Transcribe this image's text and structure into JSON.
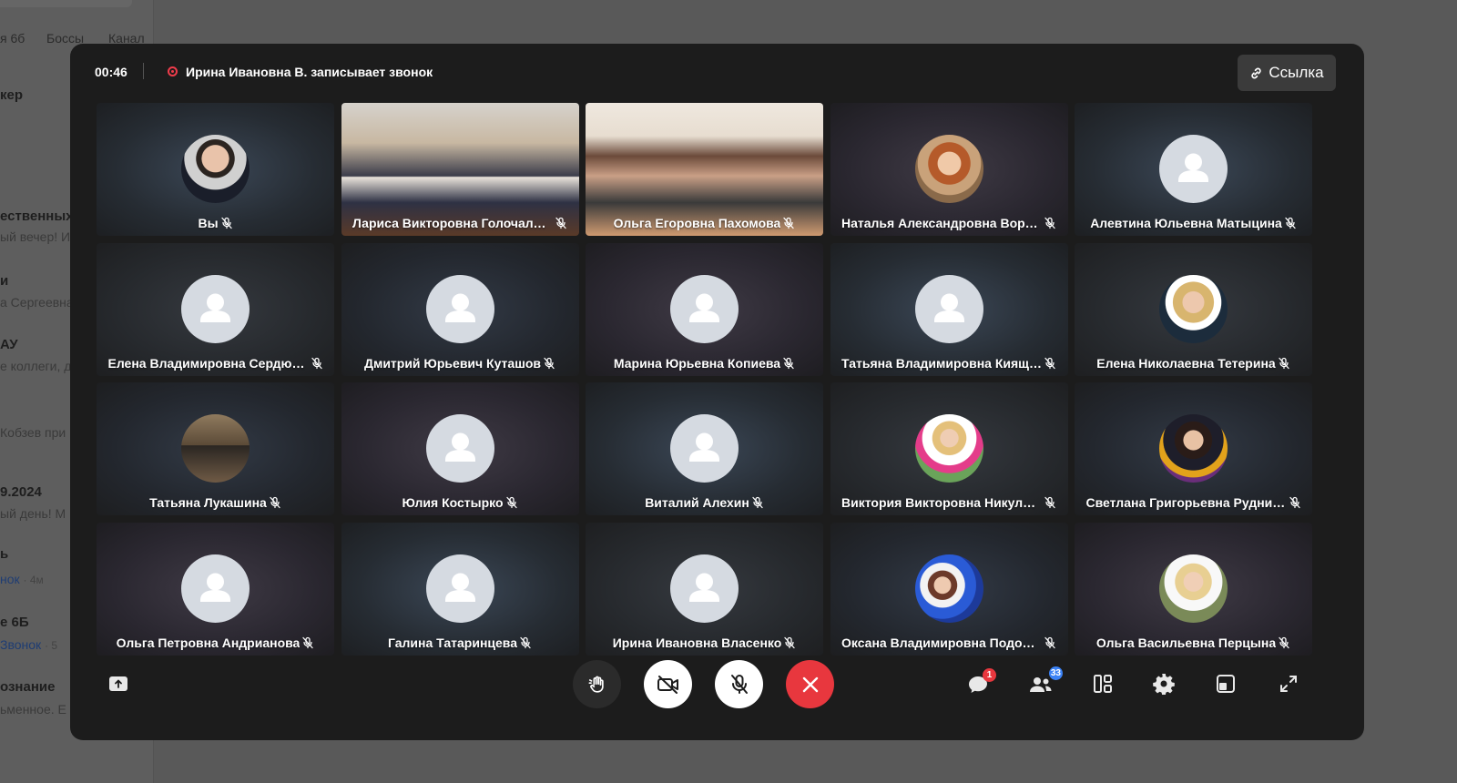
{
  "background": {
    "tabs": [
      "я 6б",
      "Боссы",
      "Канал"
    ],
    "items": [
      {
        "text": "кер",
        "style": "bold"
      },
      {
        "text": "ественных",
        "style": "bold"
      },
      {
        "text": "ый вечер! И",
        "style": "dim"
      },
      {
        "text": "и",
        "style": "bold"
      },
      {
        "text": "а Сергеевна",
        "style": "dim"
      },
      {
        "text": "АУ",
        "style": "bold"
      },
      {
        "text": "е коллеги, д",
        "style": "dim"
      },
      {
        "text": "Кобзев при",
        "style": "dim"
      },
      {
        "text": "9.2024",
        "style": "bold"
      },
      {
        "text": "ый день! М",
        "style": "dim"
      },
      {
        "text": "ь",
        "style": "bold"
      },
      {
        "text": "нок",
        "style": "link",
        "meta": "· 4м"
      },
      {
        "text": "е 6Б",
        "style": "bold"
      },
      {
        "text": "Звонок",
        "style": "link",
        "meta": "· 5"
      },
      {
        "text": "ознание",
        "style": "bold"
      },
      {
        "text": "ьменное. Е",
        "style": "dim"
      }
    ]
  },
  "call": {
    "timer": "00:46",
    "recording_text": "Ирина Ивановна В. записывает звонок",
    "link_label": "Ссылка",
    "colors": {
      "window": "#1c1c1c",
      "end_call": "#e8373e",
      "badge_red": "#e8373e",
      "badge_blue": "#3b82f6"
    },
    "participants": [
      {
        "name": "Вы",
        "avatar": "photo-man"
      },
      {
        "name": "Лариса Викторовна Голочалова",
        "avatar": "video-1"
      },
      {
        "name": "Ольга Егоровна Пахомова",
        "avatar": "video-2"
      },
      {
        "name": "Наталья Александровна Вороб...",
        "avatar": "photo-woman-red"
      },
      {
        "name": "Алевтина Юльевна Матыцина",
        "avatar": "default"
      },
      {
        "name": "Елена Владимировна Сердюко...",
        "avatar": "default"
      },
      {
        "name": "Дмитрий Юрьевич Куташов",
        "avatar": "default"
      },
      {
        "name": "Марина Юрьевна Копиева",
        "avatar": "default"
      },
      {
        "name": "Татьяна Владимировна Кияще...",
        "avatar": "default"
      },
      {
        "name": "Елена Николаевна Тетерина",
        "avatar": "photo-woman-blonde"
      },
      {
        "name": "Татьяна Лукашина",
        "avatar": "photo-desk"
      },
      {
        "name": "Юлия Костырко",
        "avatar": "default"
      },
      {
        "name": "Виталий Алехин",
        "avatar": "default"
      },
      {
        "name": "Виктория Викторовна Никулина",
        "avatar": "photo-flowers"
      },
      {
        "name": "Светлана Григорьевна Руднико...",
        "avatar": "photo-woman-dark"
      },
      {
        "name": "Ольга Петровна Андрианова",
        "avatar": "default"
      },
      {
        "name": "Галина Татаринцева",
        "avatar": "default"
      },
      {
        "name": "Ирина Ивановна Власенко",
        "avatar": "default"
      },
      {
        "name": "Оксана Владимировна Подорога",
        "avatar": "photo-balloons"
      },
      {
        "name": "Ольга Васильевна Перцына",
        "avatar": "photo-woman-plant"
      }
    ],
    "controls": {
      "share_screen_icon": "upload-screen-icon",
      "raise_hand_icon": "raise-hand-icon",
      "camera_icon": "camera-off-icon",
      "mic_icon": "mic-off-icon",
      "end_icon": "close-icon",
      "chat_badge": "1",
      "participants_badge": "33"
    }
  }
}
